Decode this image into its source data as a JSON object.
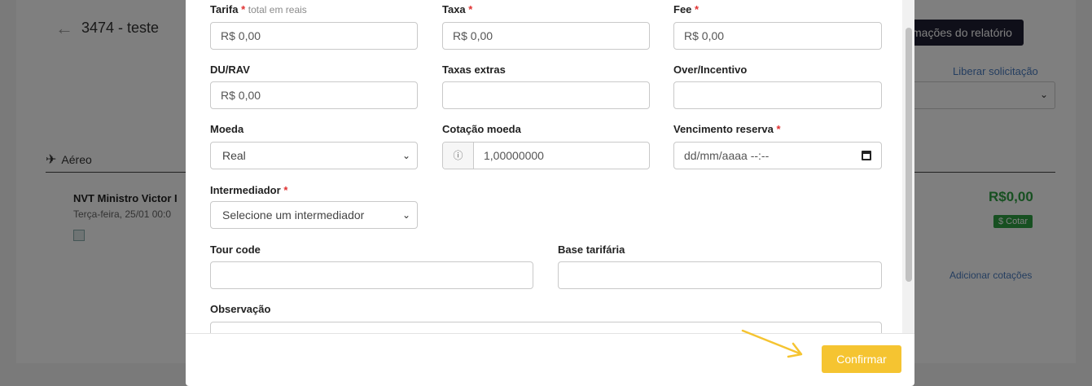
{
  "background": {
    "title": "3474 - teste",
    "report_button": "mações do relatório",
    "release_link": "Liberar solicitação",
    "section_label": "Aéreo",
    "flight_name": "NVT Ministro Victor I",
    "flight_date": "Terça-feira, 25/01 00:0",
    "price": "R$0,00",
    "quote_badge": "$ Cotar",
    "add_quotes_link": "Adicionar cotações"
  },
  "form": {
    "tarifa": {
      "label": "Tarifa",
      "hint": "total em reais",
      "value": "R$ 0,00",
      "required": "*"
    },
    "taxa": {
      "label": "Taxa",
      "value": "R$ 0,00",
      "required": "*"
    },
    "fee": {
      "label": "Fee",
      "value": "R$ 0,00",
      "required": "*"
    },
    "du_rav": {
      "label": "DU/RAV",
      "value": "R$ 0,00"
    },
    "taxas_extras": {
      "label": "Taxas extras",
      "value": ""
    },
    "over_incentivo": {
      "label": "Over/Incentivo",
      "value": ""
    },
    "moeda": {
      "label": "Moeda",
      "selected": "Real"
    },
    "cotacao_moeda": {
      "label": "Cotação moeda",
      "value": "1,00000000"
    },
    "vencimento_reserva": {
      "label": "Vencimento reserva",
      "placeholder": "dd/mm/aaaa --:--",
      "required": "*"
    },
    "intermediador": {
      "label": "Intermediador",
      "selected": "Selecione um intermediador",
      "required": "*"
    },
    "tour_code": {
      "label": "Tour code",
      "value": ""
    },
    "base_tarifaria": {
      "label": "Base tarifária",
      "value": ""
    },
    "observacao": {
      "label": "Observação",
      "value": ""
    }
  },
  "footer": {
    "confirm_label": "Confirmar"
  },
  "colors": {
    "confirm": "#f5c431",
    "required": "#e03131",
    "price": "#2ea043",
    "link": "#4a7cc0"
  },
  "icons": [
    "arrow-left-icon",
    "airplane-icon",
    "chevron-down-icon",
    "info-icon",
    "calendar-icon",
    "broken-image-icon",
    "annotation-arrow-icon"
  ]
}
